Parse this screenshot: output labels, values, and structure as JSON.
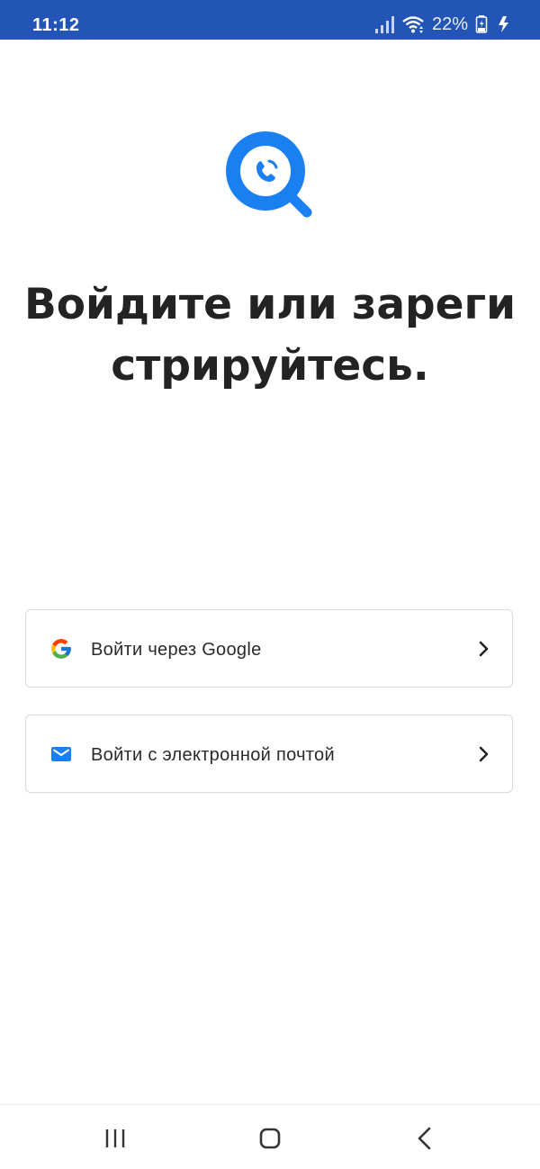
{
  "status_bar": {
    "time": "11:12",
    "battery": "22%",
    "background_color": "#2255b5"
  },
  "app": {
    "logo_icon": "search-phone-icon",
    "brand_color": "#1a7ff0",
    "heading": "Войдите или зарегистрируйтесь."
  },
  "auth": {
    "google_label": "Войти через Google",
    "google_icon": "google-icon",
    "email_label": "Войти с электронной почтой",
    "email_icon": "mail-icon",
    "chevron_icon": "chevron-right-icon"
  },
  "navigation": {
    "recent_icon": "recent-apps-icon",
    "home_icon": "home-icon",
    "back_icon": "back-icon"
  }
}
